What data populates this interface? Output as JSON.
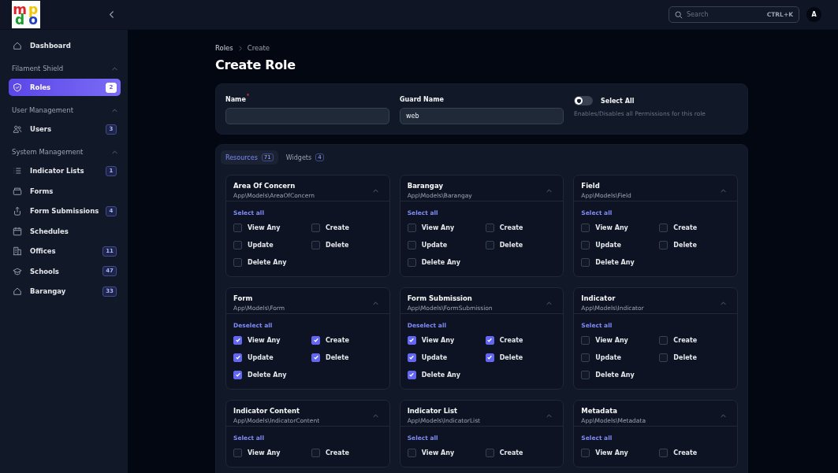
{
  "logo": {
    "letters": [
      {
        "text": "m",
        "color": "#e0202a"
      },
      {
        "text": "p",
        "color": "#f2c500"
      },
      {
        "text": "d",
        "color": "#1a9a2a"
      },
      {
        "text": "o",
        "color": "#1f3fc4"
      }
    ]
  },
  "topbar": {
    "search": {
      "placeholder": "Search",
      "shortcut": "CTRL+K"
    },
    "avatar": "A"
  },
  "sidebar": {
    "items": [
      {
        "kind": "item",
        "label": "Dashboard",
        "selected": false
      },
      {
        "kind": "group",
        "label": "Filament Shield",
        "expanded": true
      },
      {
        "kind": "item",
        "label": "Roles",
        "badge": "2",
        "selected": true
      },
      {
        "kind": "group",
        "label": "User Management",
        "expanded": true
      },
      {
        "kind": "item",
        "label": "Users",
        "badge": "3",
        "selected": false
      },
      {
        "kind": "group",
        "label": "System Management",
        "expanded": true
      },
      {
        "kind": "item",
        "label": "Indicator Lists",
        "badge": "1",
        "selected": false
      },
      {
        "kind": "item",
        "label": "Forms",
        "selected": false
      },
      {
        "kind": "item",
        "label": "Form Submissions",
        "badge": "4",
        "selected": false
      },
      {
        "kind": "item",
        "label": "Schedules",
        "selected": false
      },
      {
        "kind": "item",
        "label": "Offices",
        "badge": "11",
        "selected": false
      },
      {
        "kind": "item",
        "label": "Schools",
        "badge": "47",
        "selected": false
      },
      {
        "kind": "item",
        "label": "Barangay",
        "badge": "33",
        "selected": false
      }
    ]
  },
  "breadcrumbs": [
    "Roles",
    "Create"
  ],
  "page_title": "Create Role",
  "form": {
    "name": {
      "label": "Name",
      "required_mark": "*"
    },
    "guard": {
      "label": "Guard Name",
      "value": "web"
    },
    "select_all": {
      "label": "Select All",
      "on": false,
      "hint": "Enables/Disables all Permissions for this role"
    }
  },
  "tabs": [
    {
      "label": "Resources",
      "count": "71",
      "selected": true
    },
    {
      "label": "Widgets",
      "count": "4",
      "selected": false
    }
  ],
  "resources": [
    {
      "title": "Area Of Concern",
      "model": "App\\Models\\AreaOfConcern",
      "expanded": true,
      "action": "Select all",
      "permissions": [
        {
          "label": "View Any",
          "checked": false
        },
        {
          "label": "Create",
          "checked": false
        },
        {
          "label": "Update",
          "checked": false
        },
        {
          "label": "Delete",
          "checked": false
        },
        {
          "label": "Delete Any",
          "checked": false
        }
      ]
    },
    {
      "title": "Barangay",
      "model": "App\\Models\\Barangay",
      "expanded": true,
      "action": "Select all",
      "permissions": [
        {
          "label": "View Any",
          "checked": false
        },
        {
          "label": "Create",
          "checked": false
        },
        {
          "label": "Update",
          "checked": false
        },
        {
          "label": "Delete",
          "checked": false
        },
        {
          "label": "Delete Any",
          "checked": false
        }
      ]
    },
    {
      "title": "Field",
      "model": "App\\Models\\Field",
      "expanded": true,
      "action": "Select all",
      "permissions": [
        {
          "label": "View Any",
          "checked": false
        },
        {
          "label": "Create",
          "checked": false
        },
        {
          "label": "Update",
          "checked": false
        },
        {
          "label": "Delete",
          "checked": false
        },
        {
          "label": "Delete Any",
          "checked": false
        }
      ]
    },
    {
      "title": "Form",
      "model": "App\\Models\\Form",
      "expanded": true,
      "action": "Deselect all",
      "permissions": [
        {
          "label": "View Any",
          "checked": true
        },
        {
          "label": "Create",
          "checked": true
        },
        {
          "label": "Update",
          "checked": true
        },
        {
          "label": "Delete",
          "checked": true
        },
        {
          "label": "Delete Any",
          "checked": true
        }
      ]
    },
    {
      "title": "Form Submission",
      "model": "App\\Models\\FormSubmission",
      "expanded": true,
      "action": "Deselect all",
      "permissions": [
        {
          "label": "View Any",
          "checked": true
        },
        {
          "label": "Create",
          "checked": true
        },
        {
          "label": "Update",
          "checked": true
        },
        {
          "label": "Delete",
          "checked": true
        },
        {
          "label": "Delete Any",
          "checked": true
        }
      ]
    },
    {
      "title": "Indicator",
      "model": "App\\Models\\Indicator",
      "expanded": true,
      "action": "Select all",
      "permissions": [
        {
          "label": "View Any",
          "checked": false
        },
        {
          "label": "Create",
          "checked": false
        },
        {
          "label": "Update",
          "checked": false
        },
        {
          "label": "Delete",
          "checked": false
        },
        {
          "label": "Delete Any",
          "checked": false
        }
      ]
    },
    {
      "title": "Indicator Content",
      "model": "App\\Models\\IndicatorContent",
      "expanded": true,
      "action": "Select all",
      "permissions": [
        {
          "label": "View Any",
          "checked": false
        },
        {
          "label": "Create",
          "checked": false
        }
      ]
    },
    {
      "title": "Indicator List",
      "model": "App\\Models\\IndicatorList",
      "expanded": true,
      "action": "Select all",
      "permissions": [
        {
          "label": "View Any",
          "checked": false
        },
        {
          "label": "Create",
          "checked": false
        }
      ]
    },
    {
      "title": "Metadata",
      "model": "App\\Models\\Metadata",
      "expanded": true,
      "action": "Select all",
      "permissions": [
        {
          "label": "View Any",
          "checked": false
        },
        {
          "label": "Create",
          "checked": false
        }
      ]
    }
  ]
}
